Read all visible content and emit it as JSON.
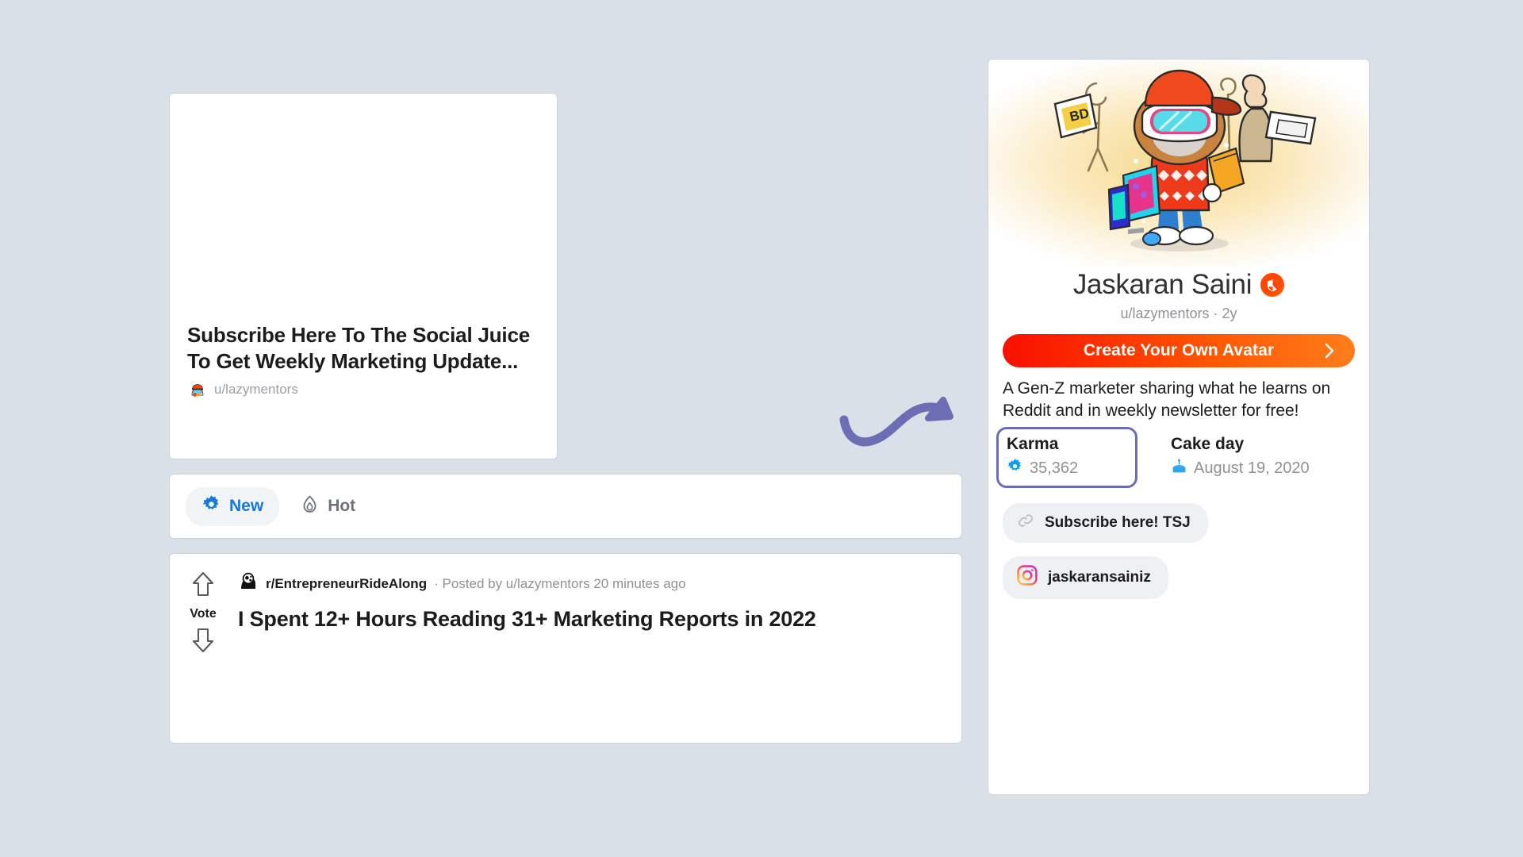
{
  "page": {
    "background_color": "#dae0e8"
  },
  "left_column": {
    "promo_post": {
      "title": "Subscribe Here To The Social Juice To Get Weekly Marketing Update...",
      "author": "u/lazymentors",
      "avatar_icon": "reddit-avatar-icon"
    },
    "sort_tabs": [
      {
        "label": "New",
        "icon": "sparkle-badge-icon",
        "active": true,
        "accent_color": "#1479d8"
      },
      {
        "label": "Hot",
        "icon": "flame-icon",
        "active": false,
        "accent_color": "#6d7278"
      }
    ],
    "feed_post": {
      "vote_label": "Vote",
      "upvote_icon": "arrow-up-icon",
      "downvote_icon": "arrow-down-icon",
      "subreddit_icon": "head-with-gears-icon",
      "subreddit": "r/EntrepreneurRideAlong",
      "meta": "· Posted by u/lazymentors 20 minutes ago",
      "title": "I Spent 12+ Hours Reading 31+ Marketing Reports in 2022"
    }
  },
  "profile_panel": {
    "avatar_icon": "reddit-snoo-avatar-illustration",
    "display_name": "Jaskaran Saini",
    "verified_badge_icon": "reddit-verified-shield-icon",
    "verified_badge_color": "#ff4500",
    "handle": "u/lazymentors · 2y",
    "create_avatar_button": {
      "label": "Create Your Own Avatar",
      "chevron_icon": "chevron-right-icon",
      "gradient_from": "#fa0f00",
      "gradient_to": "#ff7d1a"
    },
    "bio": "A Gen-Z marketer sharing what he learns on Reddit and in weekly newsletter for free!",
    "stats": {
      "karma": {
        "label": "Karma",
        "value": "35,362",
        "icon": "karma-burst-icon",
        "icon_color": "#0d9ef0",
        "highlight_border_color": "#6d6db5"
      },
      "cake_day": {
        "label": "Cake day",
        "value": "August 19, 2020",
        "icon": "cake-icon",
        "icon_color": "#30a3f1"
      }
    },
    "chips": [
      {
        "label": "Subscribe here! TSJ",
        "icon": "link-chain-icon"
      },
      {
        "label": "jaskaransainiz",
        "icon": "instagram-icon"
      }
    ]
  },
  "annotation": {
    "arrow_icon": "curved-arrow-icon",
    "color": "#6d6db5"
  }
}
